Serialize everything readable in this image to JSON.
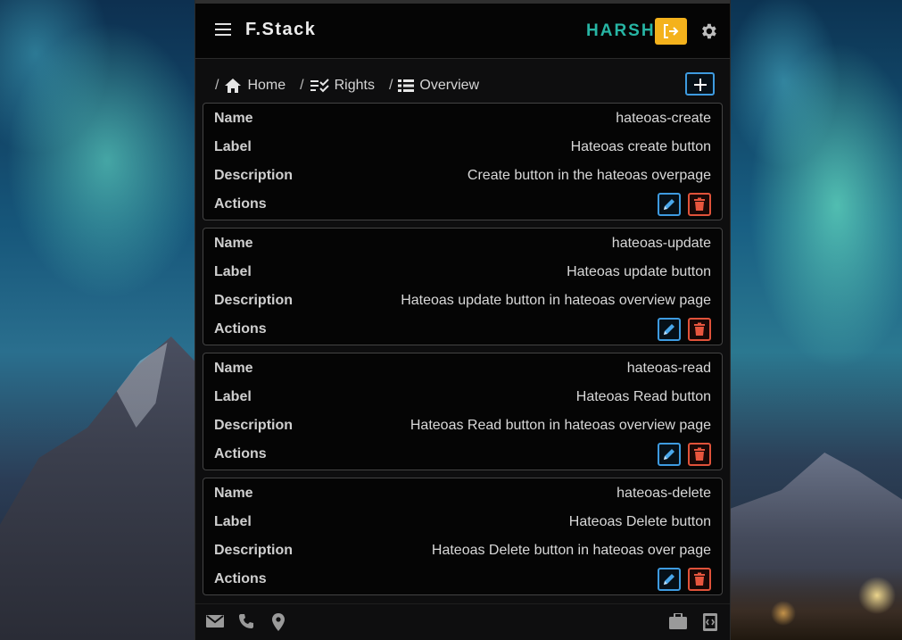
{
  "app": {
    "brand": "F.Stack",
    "username": "HARSH",
    "icons": {
      "menu": "menu-icon",
      "logout": "logout-icon",
      "settings": "gear-icon"
    }
  },
  "breadcrumb": [
    {
      "label": "Home",
      "icon": "home-icon"
    },
    {
      "label": "Rights",
      "icon": "checklist-icon"
    },
    {
      "label": "Overview",
      "icon": "list-icon"
    }
  ],
  "labels": {
    "name": "Name",
    "label": "Label",
    "description": "Description",
    "actions": "Actions"
  },
  "items": [
    {
      "name": "hateoas-create",
      "label": "Hateoas create button",
      "description": "Create button in the hateoas overpage"
    },
    {
      "name": "hateoas-update",
      "label": "Hateoas update button",
      "description": "Hateoas update button in hateoas overview page"
    },
    {
      "name": "hateoas-read",
      "label": "Hateoas Read button",
      "description": "Hateoas Read button in hateoas overview page"
    },
    {
      "name": "hateoas-delete",
      "label": "Hateoas Delete button",
      "description": "Hateoas Delete button in hateoas over page"
    }
  ],
  "footer": {
    "icons": [
      "mail-icon",
      "phone-icon",
      "location-icon",
      "briefcase-icon",
      "api-icon"
    ]
  },
  "colors": {
    "accent_teal": "#27b5a4",
    "logout_yellow": "#f4b21c",
    "edit_blue": "#3e9be0",
    "delete_red": "#e0523a"
  }
}
